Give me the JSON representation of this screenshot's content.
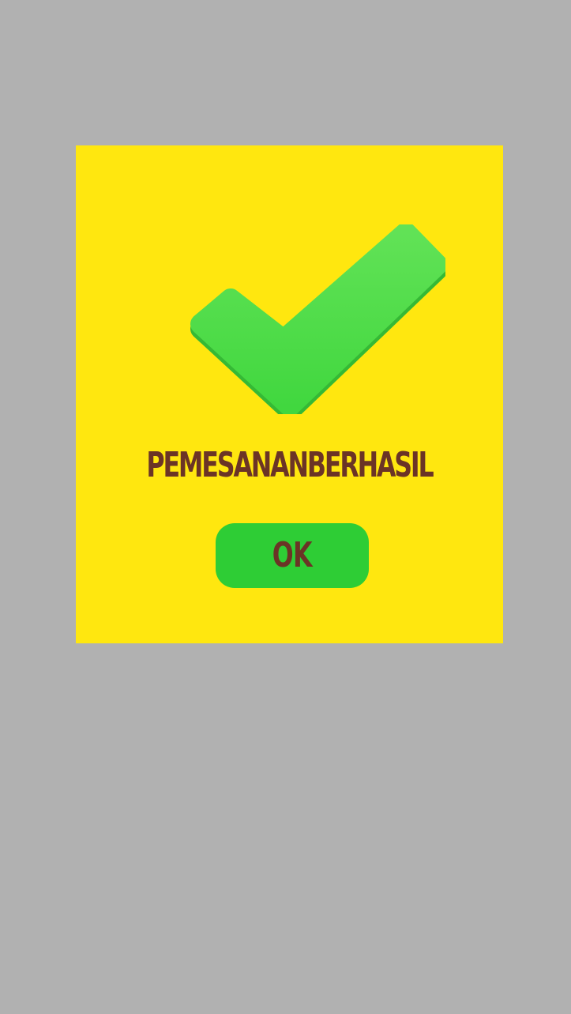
{
  "dialog": {
    "message": "PEMESANANBERHASIL",
    "ok_label": "OK",
    "icon": "checkmark-icon"
  },
  "colors": {
    "background": "#b1b1b1",
    "dialog": "#ffe70f",
    "check": "#4ddb48",
    "button": "#2ecd35",
    "text": "#6b3426"
  }
}
